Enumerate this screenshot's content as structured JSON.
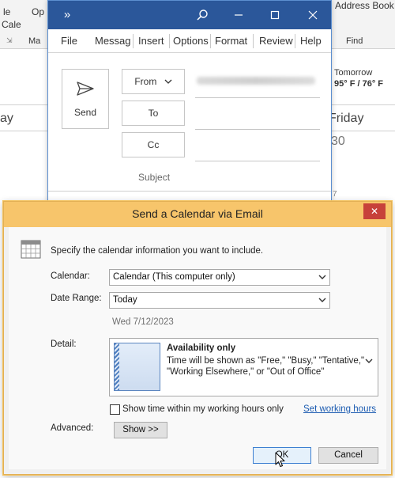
{
  "background": {
    "ribbon_left_top": "le",
    "ribbon_left_mid": "Cale",
    "ribbon_left_low": "Ma",
    "ribbon_open_top": "Op",
    "ribbon_address_book": "Address Book",
    "ribbon_find": "Find",
    "weather_day": "Tomorrow",
    "weather_temp": "95° F / 76° F",
    "day_left": "ay",
    "day_right": "Friday",
    "date_right": "30",
    "small_seven": "7"
  },
  "message_window": {
    "title_icon": "»",
    "tabs": [
      "File",
      "Messag",
      "Insert",
      "Options",
      "Format",
      "Review",
      "Help"
    ],
    "send_label": "Send",
    "from_label": "From",
    "to_label": "To",
    "cc_label": "Cc",
    "subject_label": "Subject"
  },
  "dialog": {
    "title": "Send a Calendar via Email",
    "close_glyph": "✕",
    "instruction": "Specify the calendar information you want to include.",
    "calendar_label": "Calendar:",
    "calendar_value": "Calendar (This computer only)",
    "date_range_label": "Date Range:",
    "date_range_value": "Today",
    "date_text": "Wed 7/12/2023",
    "detail_label": "Detail:",
    "detail_title": "Availability only",
    "detail_line1": "Time will be shown as \"Free,\" \"Busy,\" \"Tentative,\"",
    "detail_line2": "\"Working Elsewhere,\" or \"Out of Office\"",
    "working_hours_checkbox_label": "Show time within my working hours only",
    "working_hours_checked": false,
    "set_working_hours_link": "Set working hours",
    "advanced_label": "Advanced:",
    "show_button": "Show >>",
    "ok_button": "OK",
    "cancel_button": "Cancel"
  },
  "colors": {
    "outlook_blue": "#2b579a",
    "dialog_title_bar": "#f7c56b",
    "close_red": "#c7413a",
    "link_blue": "#1b5bb1"
  }
}
